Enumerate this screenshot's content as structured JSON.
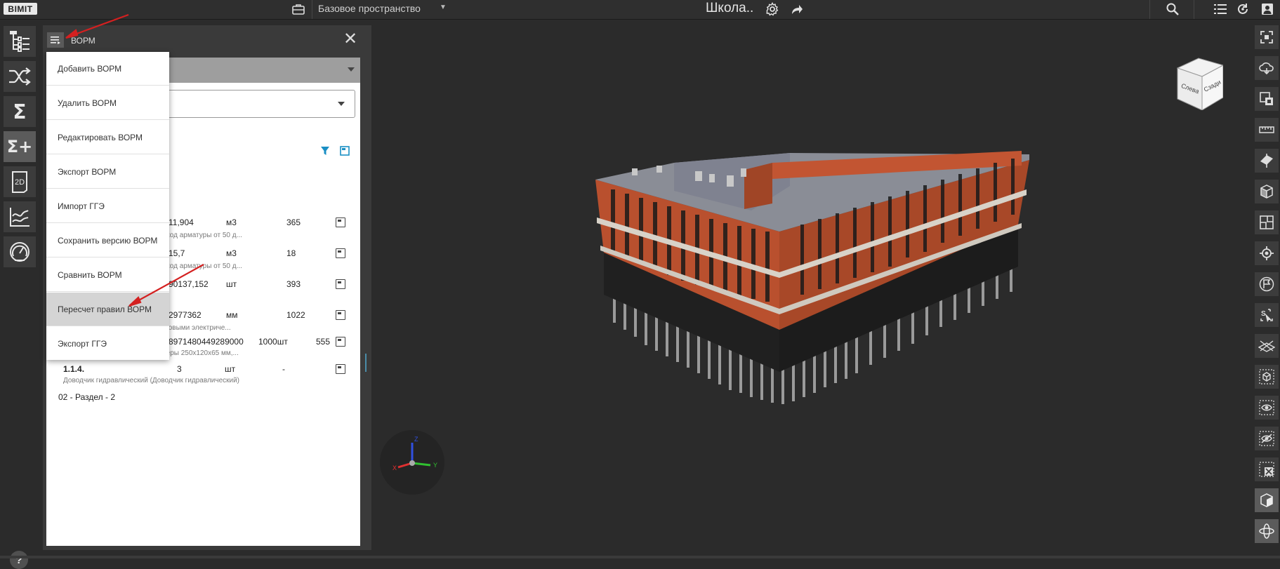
{
  "app": {
    "logo_text": "BIMIT"
  },
  "topbar": {
    "space_label": "Базовое пространство",
    "project_title": "Школа..",
    "icons": [
      "briefcase-icon",
      "chevron-down-icon",
      "gear-icon",
      "share-icon",
      "search-icon",
      "list-icon",
      "refresh-icon",
      "user-icon"
    ]
  },
  "left_toolbar": {
    "items": [
      "tree-structure-icon",
      "shuffle-icon",
      "sigma-icon",
      "sigma-plus-icon",
      "2d-drawing-icon",
      "chart-lines-icon",
      "gauge-icon"
    ],
    "active": "sigma-plus-icon",
    "help_label": "?"
  },
  "panel": {
    "title": "ВОРМ",
    "rows": [
      {
        "code": "",
        "qty": "11,904",
        "unit": "м3",
        "count": "365",
        "desc": "от 0,5 до 1,5 м3, бетон В20, расход арматуры от 50 д..."
      },
      {
        "code": "",
        "qty": "15,7",
        "unit": "м3",
        "count": "18",
        "desc": "от 0,5 до 1,5 м3, бетон В20, расход арматуры от 50 д..."
      },
      {
        "code": "",
        "qty": "90137,152",
        "unit": "шт",
        "count": "393",
        "desc": "вило)"
      },
      {
        "code": "",
        "qty": "2977362",
        "unit": "мм",
        "count": "1022",
        "desc": "кваторами \"драглайн\" одноковшовыми электриче..."
      },
      {
        "code": "",
        "qty": "8971480449289000",
        "unit": "1000шт",
        "count": "555",
        "desc": "й полнотелый одинарный, размеры 250х120х65 мм,..."
      },
      {
        "code": "1.1.4.",
        "qty": "3",
        "unit": "шт",
        "count": "-",
        "desc": "Доводчик гидравлический (Доводчик гидравлический)"
      }
    ],
    "section_label": "02 - Раздел - 2"
  },
  "dropdown_menu": {
    "items": [
      "Добавить ВОРМ",
      "Удалить ВОРМ",
      "Редактировать ВОРМ",
      "Экспорт ВОРМ",
      "Импорт ГГЭ",
      "Сохранить версию ВОРМ",
      "Сравнить ВОРМ",
      "Пересчет правил ВОРМ",
      "Экспорт ГГЭ"
    ],
    "highlighted": "Пересчет правил ВОРМ"
  },
  "viewport": {
    "view_cube": {
      "left_face": "Слева",
      "right_face": "Сзади"
    },
    "axes": {
      "x": "X",
      "y": "Y",
      "z": "Z"
    }
  },
  "right_toolbar": {
    "items": [
      "focus-icon",
      "cloud-icon",
      "section-box-icon",
      "ruler-icon",
      "cut-plane-icon",
      "cube-sections-icon",
      "floor-plan-icon",
      "locate-icon",
      "flag-icon",
      "smart-select-icon",
      "clear-sections-icon",
      "isolate-cube-icon",
      "show-icon",
      "hide-icon",
      "clear-selection-icon",
      "solid-view-icon",
      "orbit-icon"
    ],
    "active": [
      "solid-view-icon",
      "orbit-icon"
    ]
  },
  "colors": {
    "accent": "#1a8fc4",
    "highlight": "#d4d4d4",
    "annotation_arrow": "#d42020",
    "building_brick": "#b9502e"
  }
}
